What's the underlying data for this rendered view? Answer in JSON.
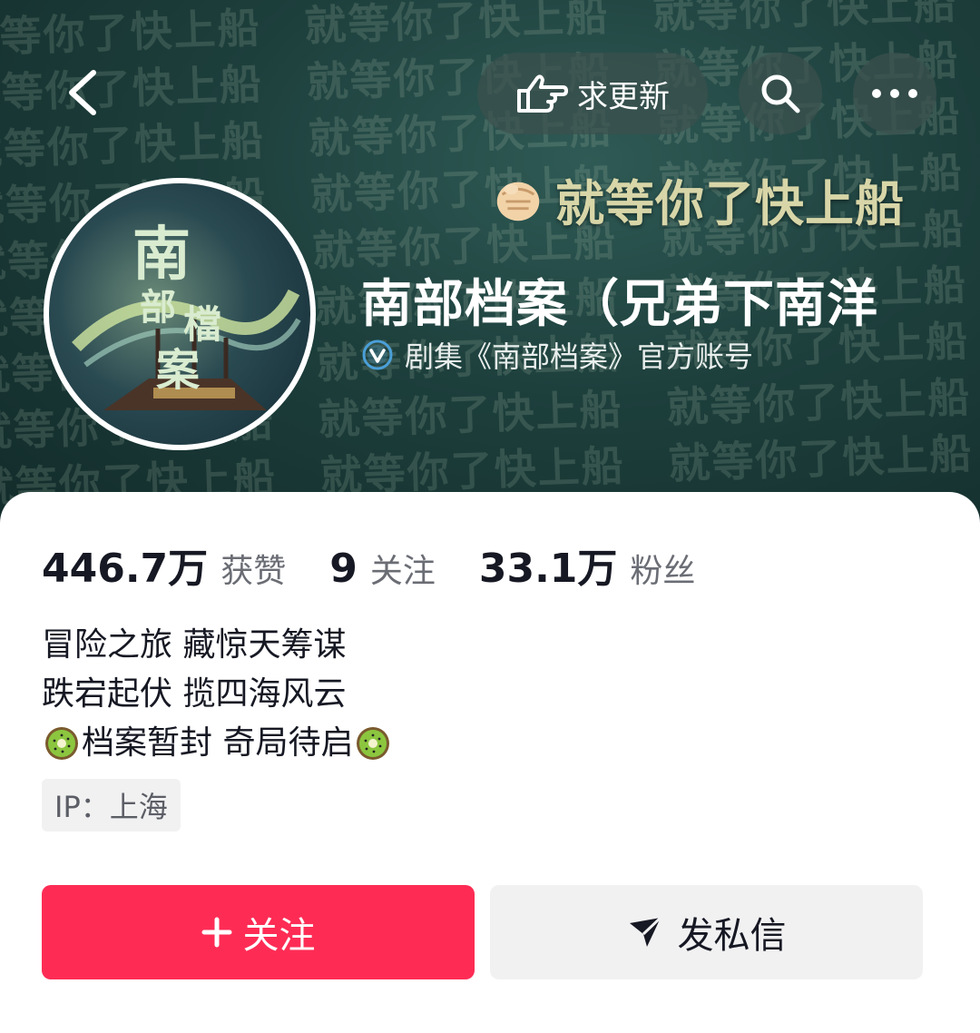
{
  "header": {
    "bg_slogan": "就等你了快上船",
    "slogan": "就等你了快上船",
    "update_label": "求更新"
  },
  "profile": {
    "name": "南部档案（兄弟下南洋",
    "verified_text": "剧集《南部档案》官方账号",
    "avatar_title_chars": [
      "南",
      "部",
      "檔",
      "案"
    ]
  },
  "stats": {
    "likes_num": "446.7万",
    "likes_label": "获赞",
    "following_num": "9",
    "following_label": "关注",
    "fans_num": "33.1万",
    "fans_label": "粉丝"
  },
  "bio": {
    "line1": "冒险之旅 藏惊天筹谋",
    "line2": "跌宕起伏 揽四海风云",
    "line3": "档案暂封 奇局待启"
  },
  "ip": "IP：上海",
  "actions": {
    "follow_label": "关注",
    "message_label": "发私信"
  },
  "colors": {
    "accent": "#fe2c55",
    "banner": "#1d3f3c",
    "verified": "#4a9fd8"
  },
  "icons": [
    "back-arrow-icon",
    "pointing-hand-icon",
    "search-icon",
    "more-icon",
    "fist-icon",
    "verified-icon",
    "kiwi-icon",
    "plus-icon",
    "send-icon"
  ]
}
